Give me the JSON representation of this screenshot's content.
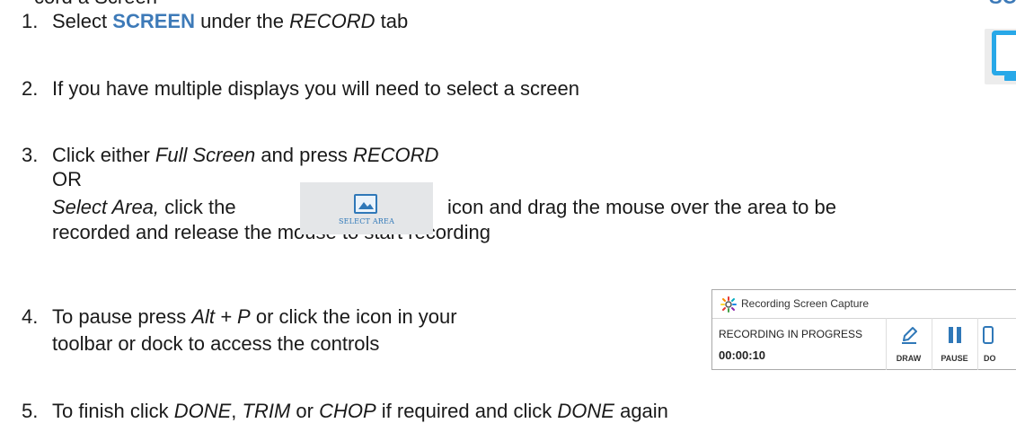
{
  "heading_fragment": "cord a Screen",
  "steps": [
    {
      "num": "1.",
      "pre": "Select ",
      "screen": "SCREEN",
      "mid": " under the ",
      "record": "RECORD",
      "post": " tab"
    },
    {
      "num": "2.",
      "text": "If you have multiple displays you will need to select a screen"
    },
    {
      "num": "3.",
      "pre": "Click either ",
      "full_screen": "Full Screen",
      "mid": " and press ",
      "record": "RECORD",
      "or": "OR",
      "select_area": "Select Area,",
      "click_the": " click the ",
      "after_icon": "icon and drag the mouse over the area to be",
      "line2": "recorded and release the mouse to start recording"
    },
    {
      "num": "4.",
      "pre": "To pause press ",
      "alt_p": "Alt + P",
      "post": " or click the icon in your",
      "line2": "toolbar or dock to access the controls"
    },
    {
      "num": "5.",
      "pre": "To finish click ",
      "done": "DONE",
      "comma": ", ",
      "trim": "TRIM",
      "or_word": " or ",
      "chop": "CHOP",
      "mid": " if required and click ",
      "done2": "DONE",
      "post": " again"
    }
  ],
  "top_right": {
    "label": "SC",
    "icon": "monitor-icon",
    "accent": "#28a8e8"
  },
  "select_area_icon": {
    "label": "SELECT AREA",
    "icon": "image-icon",
    "color": "#2f78b8"
  },
  "recorder": {
    "title": "Recording Screen Capture",
    "status": "RECORDING IN PROGRESS",
    "time": "00:00:10",
    "buttons": {
      "draw": "DRAW",
      "pause": "PAUSE",
      "done": "DO"
    },
    "icons": {
      "app": "sparkle-icon",
      "draw": "pencil-icon",
      "pause": "pause-icon",
      "done": "done-icon"
    }
  },
  "colors": {
    "accent": "#3d7ab8",
    "text": "#1a1a1a"
  }
}
